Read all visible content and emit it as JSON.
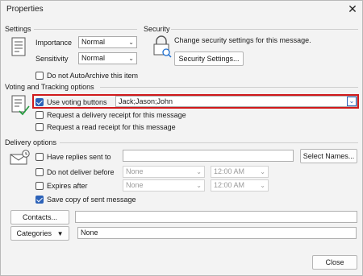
{
  "dialog": {
    "title": "Properties"
  },
  "settings": {
    "section_label": "Settings",
    "importance_label": "Importance",
    "importance_value": "Normal",
    "sensitivity_label": "Sensitivity",
    "sensitivity_value": "Normal",
    "no_autoarchive_label": "Do not AutoArchive this item"
  },
  "security": {
    "section_label": "Security",
    "description": "Change security settings for this message.",
    "button_label": "Security Settings..."
  },
  "voting": {
    "section_label": "Voting and Tracking options",
    "use_voting_label": "Use voting buttons",
    "use_voting_value": "Jack;Jason;John",
    "delivery_receipt_label": "Request a delivery receipt for this message",
    "read_receipt_label": "Request a read receipt for this message"
  },
  "delivery": {
    "section_label": "Delivery options",
    "replies_sent_to_label": "Have replies sent to",
    "replies_sent_to_value": "",
    "select_names_label": "Select Names...",
    "do_not_deliver_label": "Do not deliver before",
    "do_not_deliver_date": "None",
    "do_not_deliver_time": "12:00 AM",
    "expires_after_label": "Expires after",
    "expires_after_date": "None",
    "expires_after_time": "12:00 AM",
    "save_copy_label": "Save copy of sent message"
  },
  "contacts": {
    "button_label": "Contacts...",
    "value": ""
  },
  "categories": {
    "button_label": "Categories",
    "value": "None"
  },
  "footer": {
    "close_label": "Close"
  }
}
